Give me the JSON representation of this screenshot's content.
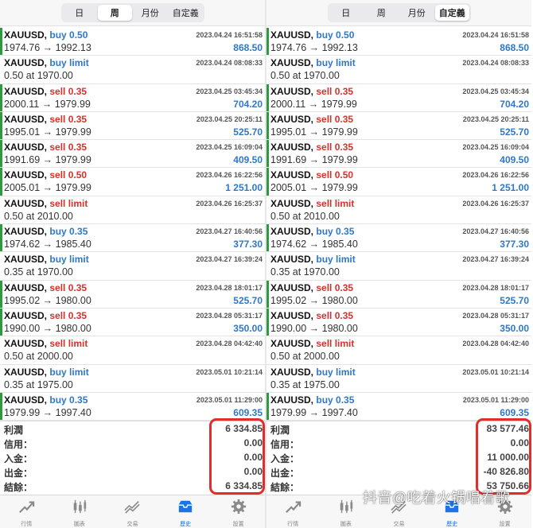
{
  "panels": [
    {
      "segments": [
        "日",
        "周",
        "月份",
        "自定義"
      ],
      "active_segment": 1,
      "orders": [
        {
          "symbol": "XAUUSD,",
          "side": "buy",
          "side_label": "buy 0.50",
          "detail": "1974.76 → 1992.13",
          "time": "2023.04.24 16:51:58",
          "profit": "868.50",
          "bar": true
        },
        {
          "symbol": "XAUUSD,",
          "side": "buy",
          "side_label": "buy limit",
          "detail": "0.50 at 1970.00",
          "time": "2023.04.24 08:08:33",
          "profit": "",
          "bar": false
        },
        {
          "symbol": "XAUUSD,",
          "side": "sell",
          "side_label": "sell 0.35",
          "detail": "2000.11 → 1979.99",
          "time": "2023.04.25 03:45:34",
          "profit": "704.20",
          "bar": true
        },
        {
          "symbol": "XAUUSD,",
          "side": "sell",
          "side_label": "sell 0.35",
          "detail": "1995.01 → 1979.99",
          "time": "2023.04.25 20:25:11",
          "profit": "525.70",
          "bar": true
        },
        {
          "symbol": "XAUUSD,",
          "side": "sell",
          "side_label": "sell 0.35",
          "detail": "1991.69 → 1979.99",
          "time": "2023.04.25 16:09:04",
          "profit": "409.50",
          "bar": true
        },
        {
          "symbol": "XAUUSD,",
          "side": "sell",
          "side_label": "sell 0.50",
          "detail": "2005.01 → 1979.99",
          "time": "2023.04.26 16:22:56",
          "profit": "1 251.00",
          "bar": true
        },
        {
          "symbol": "XAUUSD,",
          "side": "sell",
          "side_label": "sell limit",
          "detail": "0.50 at 2010.00",
          "time": "2023.04.26 16:25:37",
          "profit": "",
          "bar": false
        },
        {
          "symbol": "XAUUSD,",
          "side": "buy",
          "side_label": "buy 0.35",
          "detail": "1974.62 → 1985.40",
          "time": "2023.04.27 16:40:56",
          "profit": "377.30",
          "bar": true
        },
        {
          "symbol": "XAUUSD,",
          "side": "buy",
          "side_label": "buy limit",
          "detail": "0.35 at 1970.00",
          "time": "2023.04.27 16:39:24",
          "profit": "",
          "bar": false
        },
        {
          "symbol": "XAUUSD,",
          "side": "sell",
          "side_label": "sell 0.35",
          "detail": "1995.02 → 1980.00",
          "time": "2023.04.28 18:01:17",
          "profit": "525.70",
          "bar": true
        },
        {
          "symbol": "XAUUSD,",
          "side": "sell",
          "side_label": "sell 0.35",
          "detail": "1990.00 → 1980.00",
          "time": "2023.04.28 05:31:17",
          "profit": "350.00",
          "bar": true
        },
        {
          "symbol": "XAUUSD,",
          "side": "sell",
          "side_label": "sell limit",
          "detail": "0.50 at 2000.00",
          "time": "2023.04.28 04:42:40",
          "profit": "",
          "bar": false
        },
        {
          "symbol": "XAUUSD,",
          "side": "buy",
          "side_label": "buy limit",
          "detail": "0.35 at 1975.00",
          "time": "2023.05.01 10:21:14",
          "profit": "",
          "bar": false
        },
        {
          "symbol": "XAUUSD,",
          "side": "buy",
          "side_label": "buy 0.35",
          "detail": "1979.99 → 1997.40",
          "time": "2023.05.01 11:29:00",
          "profit": "609.35",
          "bar": true
        }
      ],
      "summary": [
        {
          "label": "利潤",
          "value": "6 334.85"
        },
        {
          "label": "信用：",
          "value": "0.00"
        },
        {
          "label": "入金：",
          "value": "0.00"
        },
        {
          "label": "出金：",
          "value": "0.00"
        },
        {
          "label": "結餘：",
          "value": "6 334.85"
        }
      ],
      "tabs": [
        "行情",
        "圖表",
        "交易",
        "歷史",
        "設置"
      ],
      "active_tab": 3
    },
    {
      "segments": [
        "日",
        "周",
        "月份",
        "自定義"
      ],
      "active_segment": 3,
      "orders": [
        {
          "symbol": "XAUUSD,",
          "side": "buy",
          "side_label": "buy 0.50",
          "detail": "1974.76 → 1992.13",
          "time": "2023.04.24 16:51:58",
          "profit": "868.50",
          "bar": true
        },
        {
          "symbol": "XAUUSD,",
          "side": "buy",
          "side_label": "buy limit",
          "detail": "0.50 at 1970.00",
          "time": "2023.04.24 08:08:33",
          "profit": "",
          "bar": false
        },
        {
          "symbol": "XAUUSD,",
          "side": "sell",
          "side_label": "sell 0.35",
          "detail": "2000.11 → 1979.99",
          "time": "2023.04.25 03:45:34",
          "profit": "704.20",
          "bar": true
        },
        {
          "symbol": "XAUUSD,",
          "side": "sell",
          "side_label": "sell 0.35",
          "detail": "1995.01 → 1979.99",
          "time": "2023.04.25 20:25:11",
          "profit": "525.70",
          "bar": true
        },
        {
          "symbol": "XAUUSD,",
          "side": "sell",
          "side_label": "sell 0.35",
          "detail": "1991.69 → 1979.99",
          "time": "2023.04.25 16:09:04",
          "profit": "409.50",
          "bar": true
        },
        {
          "symbol": "XAUUSD,",
          "side": "sell",
          "side_label": "sell 0.50",
          "detail": "2005.01 → 1979.99",
          "time": "2023.04.26 16:22:56",
          "profit": "1 251.00",
          "bar": true
        },
        {
          "symbol": "XAUUSD,",
          "side": "sell",
          "side_label": "sell limit",
          "detail": "0.50 at 2010.00",
          "time": "2023.04.26 16:25:37",
          "profit": "",
          "bar": false
        },
        {
          "symbol": "XAUUSD,",
          "side": "buy",
          "side_label": "buy 0.35",
          "detail": "1974.62 → 1985.40",
          "time": "2023.04.27 16:40:56",
          "profit": "377.30",
          "bar": true
        },
        {
          "symbol": "XAUUSD,",
          "side": "buy",
          "side_label": "buy limit",
          "detail": "0.35 at 1970.00",
          "time": "2023.04.27 16:39:24",
          "profit": "",
          "bar": false
        },
        {
          "symbol": "XAUUSD,",
          "side": "sell",
          "side_label": "sell 0.35",
          "detail": "1995.02 → 1980.00",
          "time": "2023.04.28 18:01:17",
          "profit": "525.70",
          "bar": true
        },
        {
          "symbol": "XAUUSD,",
          "side": "sell",
          "side_label": "sell 0.35",
          "detail": "1990.00 → 1980.00",
          "time": "2023.04.28 05:31:17",
          "profit": "350.00",
          "bar": true
        },
        {
          "symbol": "XAUUSD,",
          "side": "sell",
          "side_label": "sell limit",
          "detail": "0.50 at 2000.00",
          "time": "2023.04.28 04:42:40",
          "profit": "",
          "bar": false
        },
        {
          "symbol": "XAUUSD,",
          "side": "buy",
          "side_label": "buy limit",
          "detail": "0.35 at 1975.00",
          "time": "2023.05.01 10:21:14",
          "profit": "",
          "bar": false
        },
        {
          "symbol": "XAUUSD,",
          "side": "buy",
          "side_label": "buy 0.35",
          "detail": "1979.99 → 1997.40",
          "time": "2023.05.01 11:29:00",
          "profit": "609.35",
          "bar": true
        }
      ],
      "summary": [
        {
          "label": "利潤",
          "value": "83 577.46"
        },
        {
          "label": "信用：",
          "value": "0.00"
        },
        {
          "label": "入金：",
          "value": "11 000.00"
        },
        {
          "label": "出金：",
          "value": "-40 826.80"
        },
        {
          "label": "結餘：",
          "value": "53 750.66"
        }
      ],
      "tabs": [
        "行情",
        "圖表",
        "交易",
        "歷史",
        "設置"
      ],
      "active_tab": 3
    }
  ],
  "tab_icons": [
    "quotes-icon",
    "chart-icon",
    "trade-icon",
    "history-icon",
    "settings-icon"
  ],
  "colors": {
    "buy": "#2f78c8",
    "sell": "#d8312b",
    "profit": "#2f78c8",
    "bar": "#2e9a3e",
    "highlight": "#e32c2c",
    "active_tab": "#1a73e8"
  },
  "watermark": "抖音@吃着火锅唱着歌"
}
